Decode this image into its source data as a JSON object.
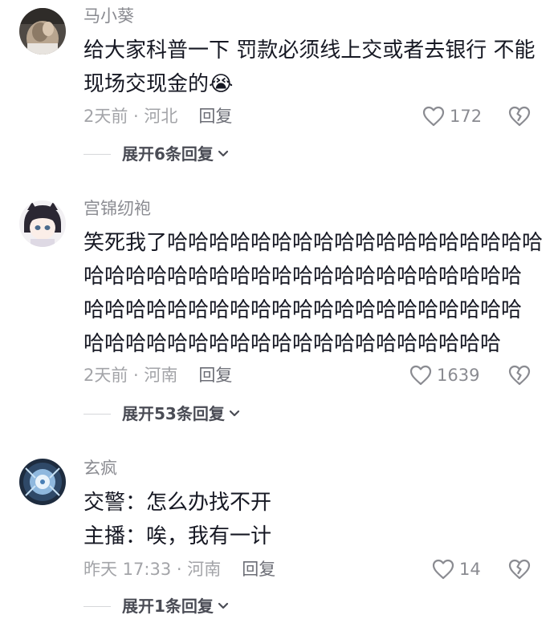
{
  "comments": [
    {
      "username": "马小葵",
      "lines": [
        "给大家科普一下 罚款必须线上交或者去银行 不能",
        "现场交现金的😭"
      ],
      "time_location": "2天前 · 河北",
      "reply_label": "回复",
      "likes": "172",
      "expand_label": "展开6条回复"
    },
    {
      "username": "宫锦纫袍",
      "lines": [
        "笑死我了哈哈哈哈哈哈哈哈哈哈哈哈哈哈哈哈哈哈",
        "哈哈哈哈哈哈哈哈哈哈哈哈哈哈哈哈哈哈哈哈哈",
        "哈哈哈哈哈哈哈哈哈哈哈哈哈哈哈哈哈哈哈哈哈",
        "哈哈哈哈哈哈哈哈哈哈哈哈哈哈哈哈哈哈哈哈"
      ],
      "time_location": "2天前 · 河南",
      "reply_label": "回复",
      "likes": "1639",
      "expand_label": "展开53条回复"
    },
    {
      "username": "玄疯",
      "lines": [
        "交警：怎么办找不开",
        "主播：唉，我有一计"
      ],
      "time_location": "昨天 17:33 · 河南",
      "reply_label": "回复",
      "likes": "14",
      "expand_label": "展开1条回复"
    }
  ],
  "icons": {
    "like": "heart-outline-icon",
    "dislike": "broken-heart-icon",
    "expand": "chevron-down-icon"
  },
  "colors": {
    "username": "#8a8b91",
    "text": "#161823",
    "meta": "#a3a4a8"
  }
}
